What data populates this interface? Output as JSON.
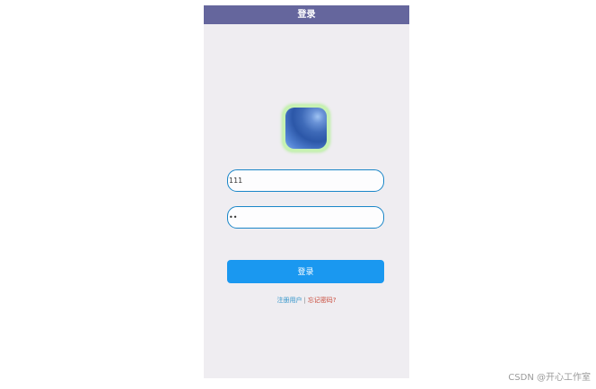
{
  "header": {
    "title": "登录"
  },
  "login_form": {
    "username_value": "111",
    "password_value": "11",
    "login_label": "登录"
  },
  "links": {
    "register": "注册用户",
    "separator": "|",
    "forgot": "忘记密码?"
  },
  "watermark": "CSDN @开心工作室",
  "colors": {
    "titlebar": "#65669d",
    "background": "#efedf1",
    "accent": "#1a98f0",
    "field_border": "#1a86c8"
  }
}
